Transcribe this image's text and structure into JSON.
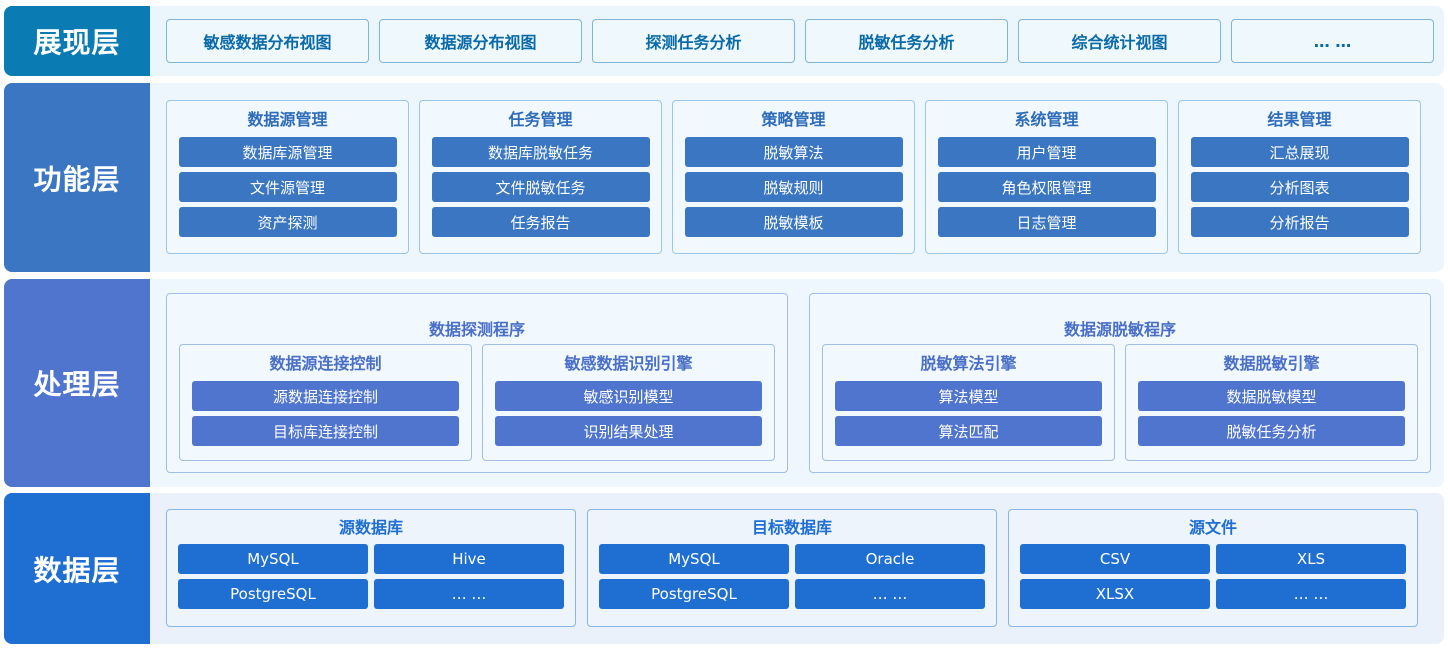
{
  "presentation_layer": {
    "label": "展现层",
    "items": [
      "敏感数据分布视图",
      "数据源分布视图",
      "探测任务分析",
      "脱敏任务分析",
      "综合统计视图",
      "… …"
    ]
  },
  "function_layer": {
    "label": "功能层",
    "groups": [
      {
        "title": "数据源管理",
        "items": [
          "数据库源管理",
          "文件源管理",
          "资产探测"
        ]
      },
      {
        "title": "任务管理",
        "items": [
          "数据库脱敏任务",
          "文件脱敏任务",
          "任务报告"
        ]
      },
      {
        "title": "策略管理",
        "items": [
          "脱敏算法",
          "脱敏规则",
          "脱敏模板"
        ]
      },
      {
        "title": "系统管理",
        "items": [
          "用户管理",
          "角色权限管理",
          "日志管理"
        ]
      },
      {
        "title": "结果管理",
        "items": [
          "汇总展现",
          "分析图表",
          "分析报告"
        ]
      }
    ]
  },
  "processing_layer": {
    "label": "处理层",
    "programs": [
      {
        "title": "数据探测程序",
        "modules": [
          {
            "title": "数据源连接控制",
            "items": [
              "源数据连接控制",
              "目标库连接控制"
            ]
          },
          {
            "title": "敏感数据识别引擎",
            "items": [
              "敏感识别模型",
              "识别结果处理"
            ]
          }
        ]
      },
      {
        "title": "数据源脱敏程序",
        "modules": [
          {
            "title": "脱敏算法引擎",
            "items": [
              "算法模型",
              "算法匹配"
            ]
          },
          {
            "title": "数据脱敏引擎",
            "items": [
              "数据脱敏模型",
              "脱敏任务分析"
            ]
          }
        ]
      }
    ]
  },
  "data_layer": {
    "label": "数据层",
    "groups": [
      {
        "title": "源数据库",
        "items": [
          "MySQL",
          "Hive",
          "PostgreSQL",
          "… …"
        ]
      },
      {
        "title": "目标数据库",
        "items": [
          "MySQL",
          "Oracle",
          "PostgreSQL",
          "… …"
        ]
      },
      {
        "title": "源文件",
        "items": [
          "CSV",
          "XLS",
          "XLSX",
          "… …"
        ]
      }
    ]
  }
}
